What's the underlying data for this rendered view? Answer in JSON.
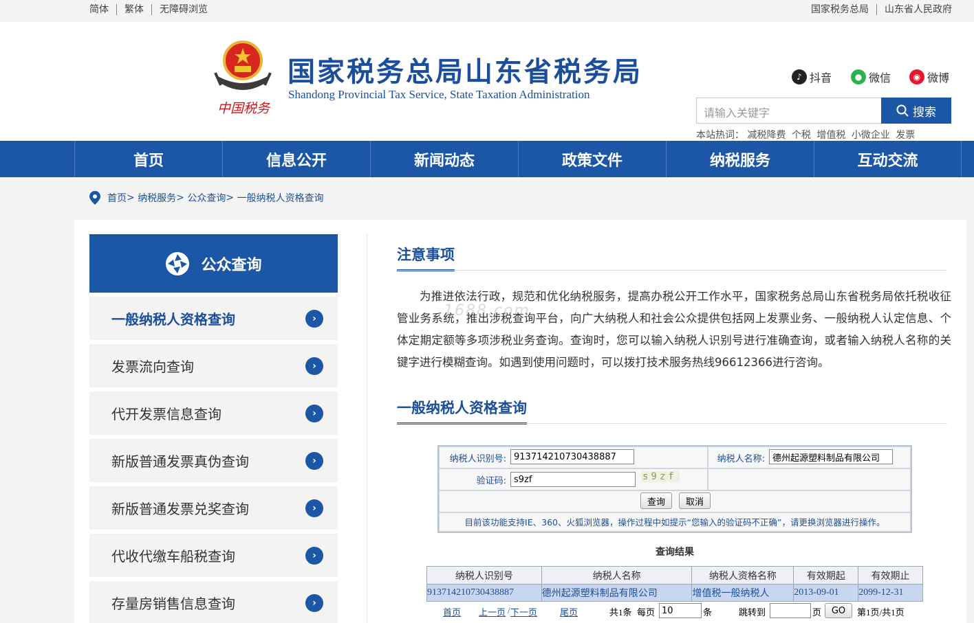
{
  "topbar": {
    "left": [
      "简体",
      "繁体",
      "无障碍浏览"
    ],
    "right": [
      "国家税务总局",
      "山东省人民政府"
    ]
  },
  "header": {
    "emblem_text": "中国税务",
    "title": "国家税务总局山东省税务局",
    "subtitle": "Shandong Provincial Tax Service, State Taxation Administration",
    "social": [
      {
        "label": "抖音",
        "icon": "douyin-icon",
        "color": "#222222"
      },
      {
        "label": "微信",
        "icon": "wechat-icon",
        "color": "#2bb24c"
      },
      {
        "label": "微博",
        "icon": "weibo-icon",
        "color": "#e6162d"
      }
    ],
    "search_placeholder": "请输入关键字",
    "search_button": "搜索",
    "hot_label": "本站热词：",
    "hot_words": [
      "减税降费",
      "个税",
      "增值税",
      "小微企业",
      "发票"
    ]
  },
  "nav": [
    "首页",
    "信息公开",
    "新闻动态",
    "政策文件",
    "纳税服务",
    "互动交流"
  ],
  "breadcrumb": [
    "首页",
    "纳税服务",
    "公众查询",
    "一般纳税人资格查询"
  ],
  "sidebar": {
    "title": "公众查询",
    "items": [
      "一般纳税人资格查询",
      "发票流向查询",
      "代开发票信息查询",
      "新版普通发票真伪查询",
      "新版普通发票兑奖查询",
      "代收代缴车船税查询",
      "存量房销售信息查询"
    ]
  },
  "notice": {
    "title": "注意事项",
    "text": "为推进依法行政，规范和优化纳税服务，提高办税公开工作水平，国家税务总局山东省税务局依托税收征管业务系统，推出涉税查询平台，向广大纳税人和社会公众提供包括网上发票业务、一般纳税人认定信息、个体定期定额等多项涉税业务查询。查询时，您可以输入纳税人识别号进行准确查询，或者输入纳税人名称的关键字进行模糊查询。如遇到使用问题时，可以拨打技术服务热线96612366进行咨询。"
  },
  "watermark": "1688.com",
  "query": {
    "title": "一般纳税人资格查询",
    "taxid_label": "纳税人识别号:",
    "taxid_value": "913714210730438887",
    "name_label": "纳税人名称:",
    "name_value": "德州起源塑料制品有限公司",
    "captcha_label": "验证码:",
    "captcha_value": "s9zf",
    "captcha_image": "s9zf",
    "query_button": "查询",
    "cancel_button": "取消",
    "note": "目前该功能支持IE、360、火狐浏览器，操作过程中如提示“您输入的验证码不正确”，请更换浏览器进行操作。"
  },
  "results": {
    "title": "查询结果",
    "columns": [
      "纳税人识别号",
      "纳税人名称",
      "纳税人资格名称",
      "有效期起",
      "有效期止"
    ],
    "rows": [
      [
        "913714210730438887",
        "德州起源塑料制品有限公司",
        "增值税一般纳税人",
        "2013-09-01",
        "2099-12-31"
      ]
    ]
  },
  "pager": {
    "first": "首页",
    "prev": "上一页",
    "slash": "/",
    "next": "下一页",
    "last": "尾页",
    "total": "共1条",
    "per_page_label": "每页",
    "per_page_value": "10",
    "per_page_unit": "条",
    "jump_label": "跳转到",
    "jump_value": "",
    "page_unit": "页",
    "go": "GO",
    "page_info": "第1页/共1页"
  }
}
